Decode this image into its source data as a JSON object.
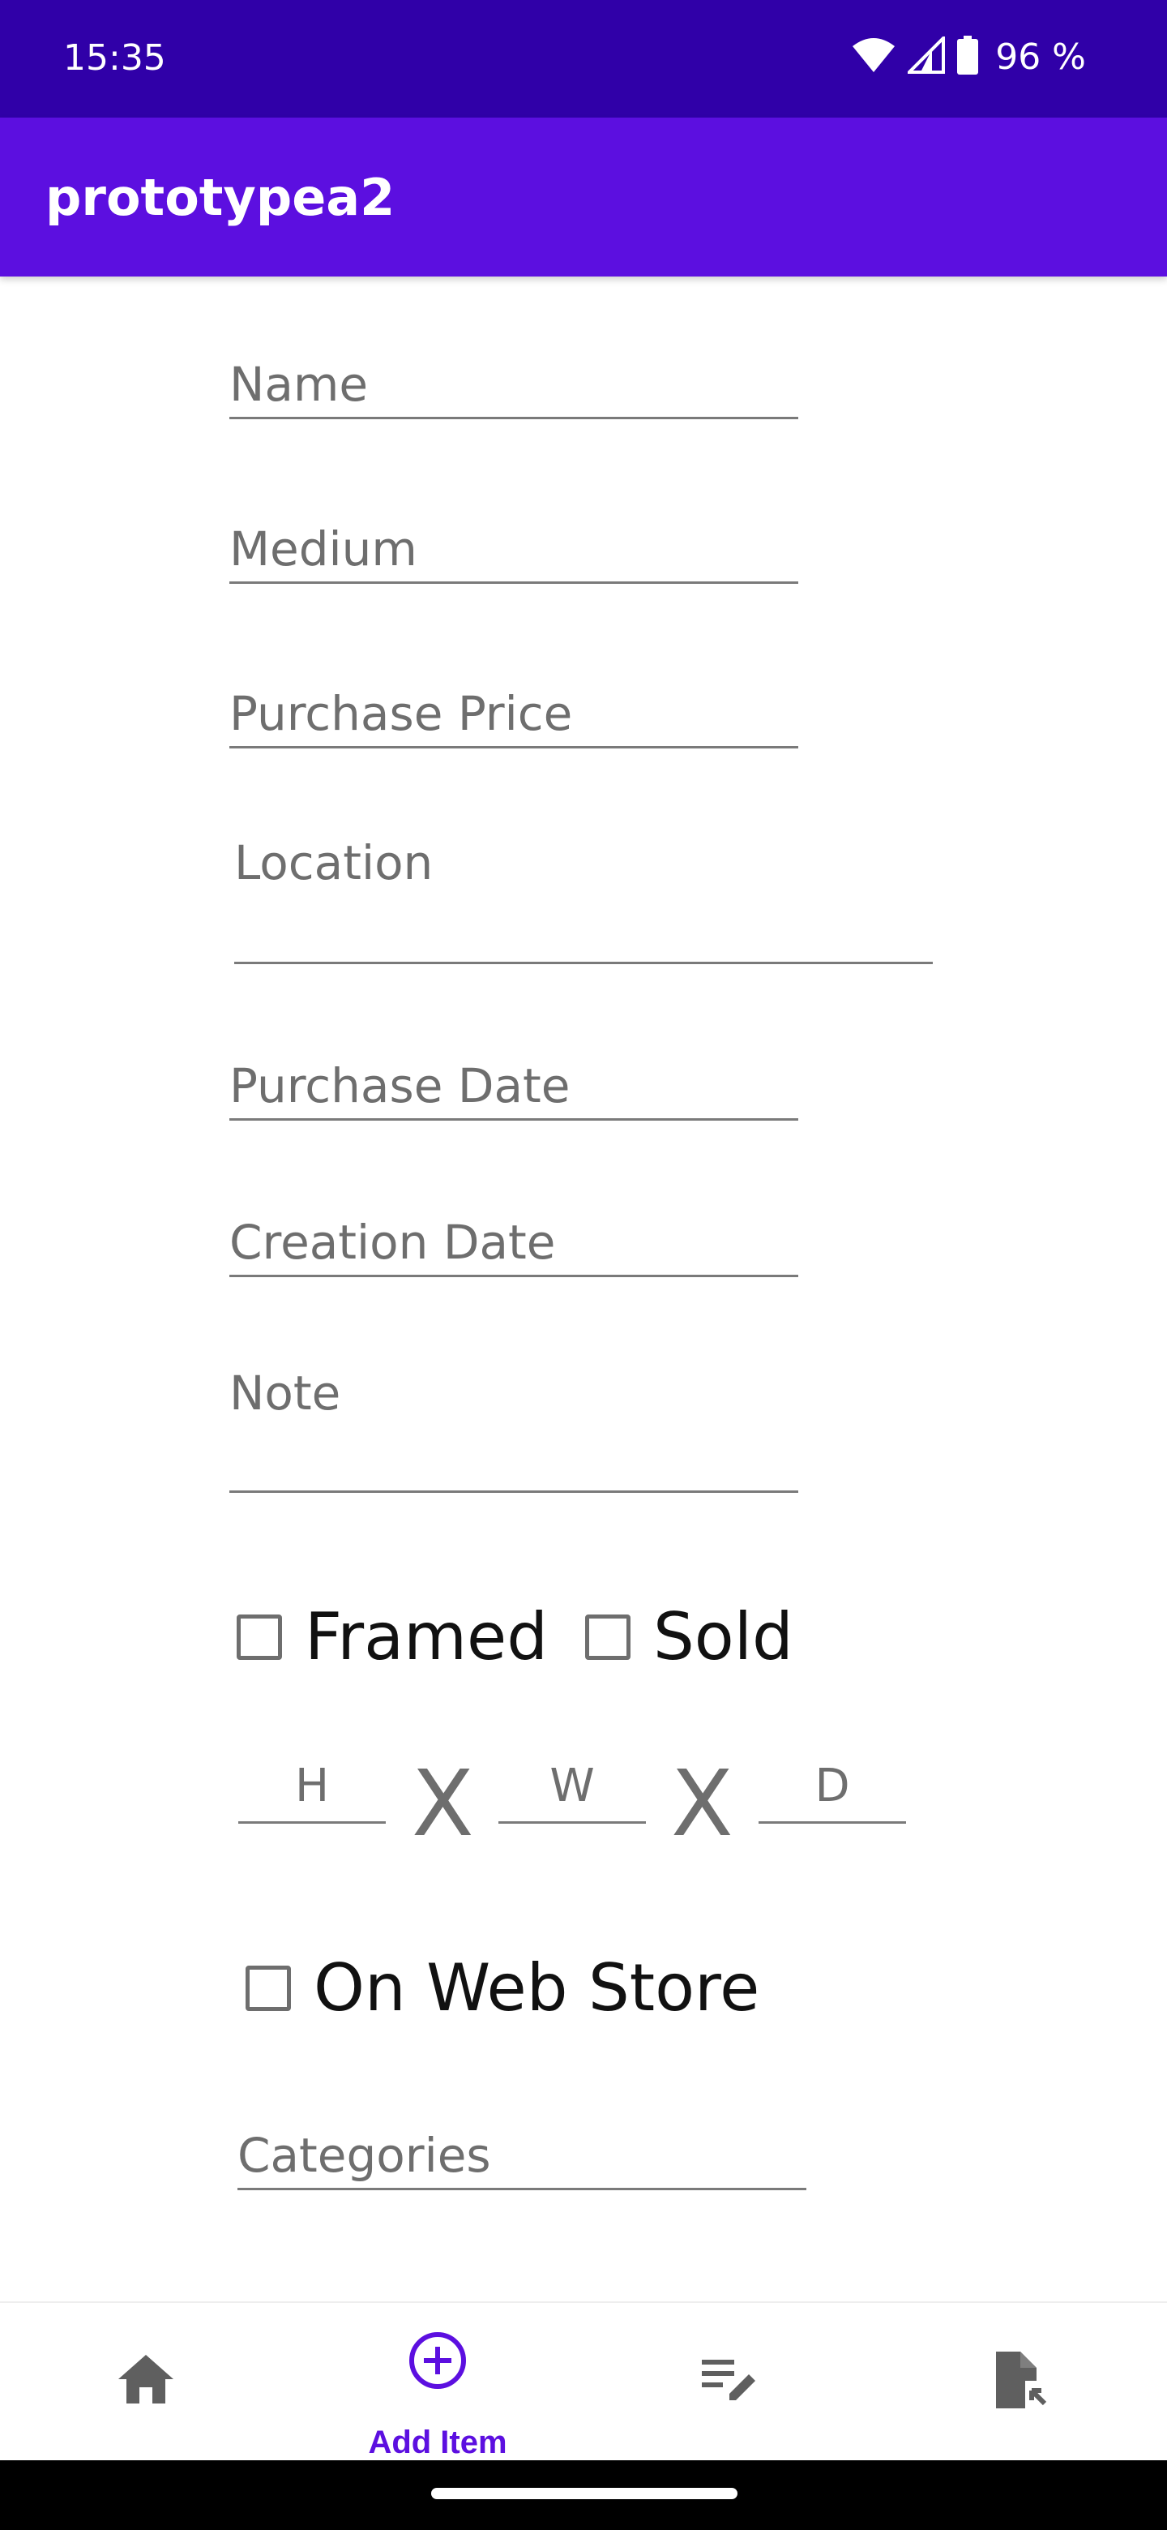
{
  "status_bar": {
    "time": "15:35",
    "battery_percent": "96 %",
    "icons": [
      "wifi-icon",
      "cell-signal-icon",
      "battery-icon"
    ],
    "background": "#3000a8"
  },
  "app_bar": {
    "title": "prototypea2",
    "color": "#5c0fe0"
  },
  "form": {
    "name_placeholder": "Name",
    "medium_placeholder": "Medium",
    "purchase_price_placeholder": "Purchase Price",
    "location_placeholder": "Location",
    "purchase_date_placeholder": "Purchase Date",
    "creation_date_placeholder": "Creation Date",
    "note_placeholder": "Note",
    "framed_label": "Framed",
    "sold_label": "Sold",
    "height_placeholder": "H",
    "width_placeholder": "W",
    "depth_placeholder": "D",
    "dimension_separator_1": "X",
    "dimension_separator_2": "X",
    "on_web_store_label": "On Web Store",
    "categories_placeholder": "Categories"
  },
  "bottom_nav": {
    "items": [
      {
        "icon": "home-icon",
        "label": ""
      },
      {
        "icon": "add-circle-icon",
        "label": "Add Item",
        "active": true
      },
      {
        "icon": "edit-list-icon",
        "label": ""
      },
      {
        "icon": "file-export-icon",
        "label": ""
      }
    ]
  }
}
